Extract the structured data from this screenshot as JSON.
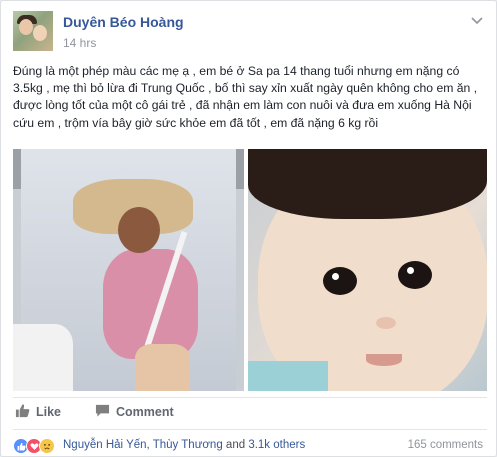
{
  "post": {
    "author": "Duyên Béo Hoàng",
    "time": "14 hrs",
    "text": "Đúng là một phép màu các mẹ ạ , em bé ở Sa pa 14 thang tuổi nhưng em nặng có 3.5kg , mẹ thì bỏ lừa đi Trung Quốc , bố thì say xỉn xuất ngày quên không cho em ăn , được lòng tốt của một cô gái trẻ , đã nhận em làm con nuôi và đưa em xuống Hà Nội cứu em , trộm vía bây giờ sức khỏe em đã tốt , em đã nặng 6 kg rồi"
  },
  "actions": {
    "like_label": "Like",
    "comment_label": "Comment"
  },
  "reactions": {
    "names": "Nguyễn Hải Yến, Thùy Thương",
    "conjunction": " and ",
    "others": "3.1k others",
    "comments": "165 comments",
    "icons": [
      "like-icon",
      "love-icon",
      "sad-icon"
    ]
  },
  "colors": {
    "link": "#365899",
    "like_blue": "#5890ff",
    "love_red": "#f25268",
    "sad_yellow": "#f7c54a"
  }
}
